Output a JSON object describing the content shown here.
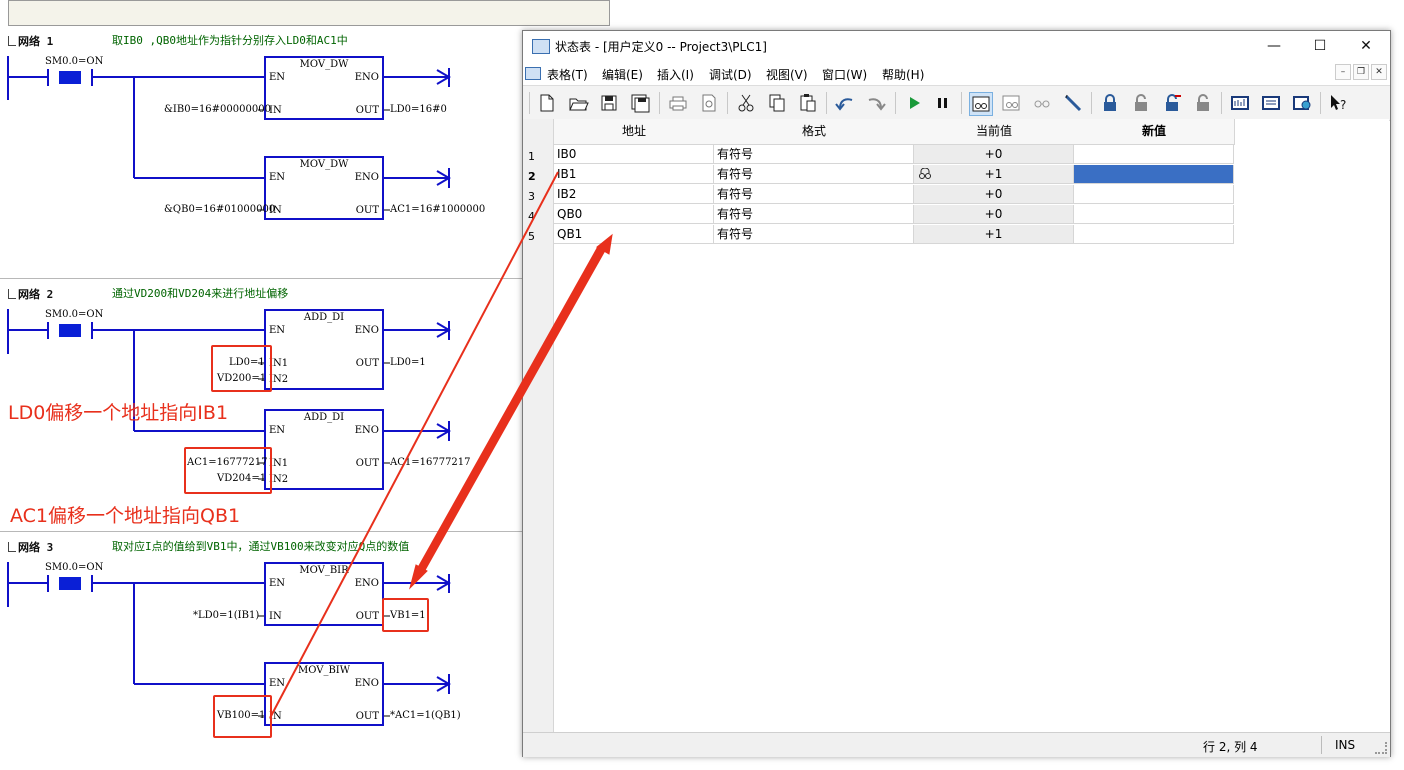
{
  "ladder": {
    "networks": [
      {
        "label": "网络 1",
        "comment": "取IB0 ,QB0地址作为指针分别存入LD0和AC1中",
        "contact": "SM0.0=ON",
        "blocks": [
          {
            "name": "MOV_DW",
            "en": "EN",
            "eno": "ENO",
            "in_label": "IN",
            "out_label": "OUT",
            "in_value": "&IB0=16#00000000",
            "out_value": "LD0=16#0"
          },
          {
            "name": "MOV_DW",
            "en": "EN",
            "eno": "ENO",
            "in_label": "IN",
            "out_label": "OUT",
            "in_value": "&QB0=16#01000000",
            "out_value": "AC1=16#1000000"
          }
        ]
      },
      {
        "label": "网络 2",
        "comment": "通过VD200和VD204来进行地址偏移",
        "contact": "SM0.0=ON",
        "blocks": [
          {
            "name": "ADD_DI",
            "en": "EN",
            "eno": "ENO",
            "in1_label": "IN1",
            "in2_label": "IN2",
            "out_label": "OUT",
            "in1_value": "LD0=1",
            "in2_value": "VD200=1",
            "out_value": "LD0=1"
          },
          {
            "name": "ADD_DI",
            "en": "EN",
            "eno": "ENO",
            "in1_label": "IN1",
            "in2_label": "IN2",
            "out_label": "OUT",
            "in1_value": "AC1=16777217",
            "in2_value": "VD204=1",
            "out_value": "AC1=16777217"
          }
        ]
      },
      {
        "label": "网络 3",
        "comment": "取对应I点的值给到VB1中，通过VB100来改变对应Q点的数值",
        "contact": "SM0.0=ON",
        "blocks": [
          {
            "name": "MOV_BIR",
            "en": "EN",
            "eno": "ENO",
            "in_label": "IN",
            "out_label": "OUT",
            "in_value": "*LD0=1(IB1)",
            "out_value": "VB1=1"
          },
          {
            "name": "MOV_BIW",
            "en": "EN",
            "eno": "ENO",
            "in_label": "IN",
            "out_label": "OUT",
            "in_value": "VB100=1",
            "out_value": "*AC1=1(QB1)"
          }
        ]
      }
    ],
    "annotations": {
      "note1": "LD0偏移一个地址指向IB1",
      "note2": "AC1偏移一个地址指向QB1"
    }
  },
  "status_window": {
    "title": "状态表 - [用户定义0 -- Project3\\PLC1]",
    "controls": {
      "minimize": "—",
      "maximize": "☐",
      "close": "✕"
    },
    "menu": [
      "表格(T)",
      "编辑(E)",
      "插入(I)",
      "调试(D)",
      "视图(V)",
      "窗口(W)",
      "帮助(H)"
    ],
    "columns": [
      "地址",
      "格式",
      "当前值",
      "新值"
    ],
    "rows": [
      {
        "num": "1",
        "address": "IB0",
        "format": "有符号",
        "current": "+0",
        "new": ""
      },
      {
        "num": "2",
        "address": "IB1",
        "format": "有符号",
        "current": "+1",
        "new": ""
      },
      {
        "num": "3",
        "address": "IB2",
        "format": "有符号",
        "current": "+0",
        "new": ""
      },
      {
        "num": "4",
        "address": "QB0",
        "format": "有符号",
        "current": "+0",
        "new": ""
      },
      {
        "num": "5",
        "address": "QB1",
        "format": "有符号",
        "current": "+1",
        "new": ""
      }
    ],
    "statusbar": {
      "position": "行 2, 列 4",
      "mode": "INS"
    },
    "colors": {
      "selected_cell": "#3a6fc4",
      "wire": "#1010c8",
      "annotation": "#e8301c"
    }
  }
}
